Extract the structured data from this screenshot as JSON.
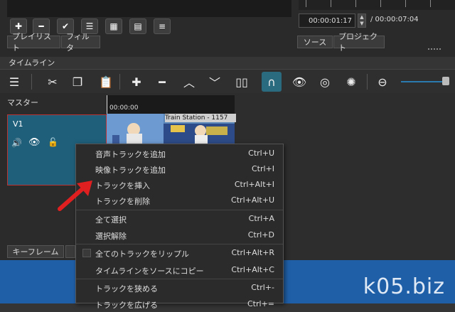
{
  "player": {
    "current_time": "00:00:01:17",
    "total_time": "/ 00:00:07:04",
    "source_tab": "ソース",
    "project_tab": "プロジェクト"
  },
  "panel_tabs": {
    "playlist": "プレイリスト",
    "filter": "フィルタ"
  },
  "timeline": {
    "title": "タイムライン",
    "master_label": "マスター",
    "track_label": "V1",
    "time_code": "00:00:00",
    "clip_title": "Train Station - 1157"
  },
  "bottom_tabs": {
    "keyframe": "キーフレーム"
  },
  "context_menu": {
    "items": [
      {
        "label": "音声トラックを追加",
        "shortcut": "Ctrl+U"
      },
      {
        "label": "映像トラックを追加",
        "shortcut": "Ctrl+I"
      },
      {
        "label": "トラックを挿入",
        "shortcut": "Ctrl+Alt+I"
      },
      {
        "label": "トラックを削除",
        "shortcut": "Ctrl+Alt+U"
      },
      {
        "label": "全て選択",
        "shortcut": "Ctrl+A"
      },
      {
        "label": "選択解除",
        "shortcut": "Ctrl+D"
      },
      {
        "label": "全てのトラックをリップル",
        "shortcut": "Ctrl+Alt+R"
      },
      {
        "label": "タイムラインをソースにコピー",
        "shortcut": "Ctrl+Alt+C"
      },
      {
        "label": "トラックを狭める",
        "shortcut": "Ctrl+-"
      },
      {
        "label": "トラックを広げる",
        "shortcut": "Ctrl+="
      }
    ]
  },
  "watermark": "k05.biz",
  "colors": {
    "accent": "#1f5f7a",
    "arrow": "#e02020",
    "strip": "#1f5fa8"
  }
}
